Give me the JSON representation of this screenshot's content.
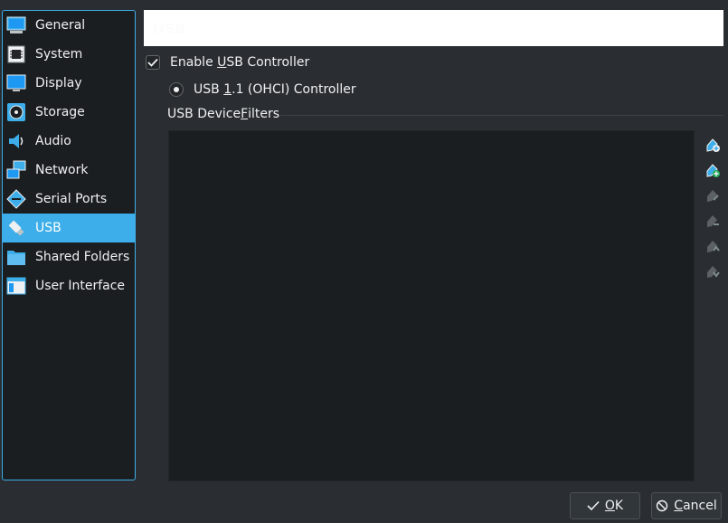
{
  "sidebar": {
    "items": [
      {
        "label": "General",
        "icon": "general-icon"
      },
      {
        "label": "System",
        "icon": "system-icon"
      },
      {
        "label": "Display",
        "icon": "display-icon"
      },
      {
        "label": "Storage",
        "icon": "storage-icon"
      },
      {
        "label": "Audio",
        "icon": "audio-icon"
      },
      {
        "label": "Network",
        "icon": "network-icon"
      },
      {
        "label": "Serial Ports",
        "icon": "serial-ports-icon"
      },
      {
        "label": "USB",
        "icon": "usb-icon",
        "selected": true
      },
      {
        "label": "Shared Folders",
        "icon": "shared-folders-icon"
      },
      {
        "label": "User Interface",
        "icon": "user-interface-icon"
      }
    ]
  },
  "page": {
    "title": "USB"
  },
  "usb": {
    "enable_label_pre": "Enable ",
    "enable_label_key": "U",
    "enable_label_post": "SB Controller",
    "enabled": true,
    "controller_pre": "USB ",
    "controller_key": "1",
    "controller_post": ".1 (OHCI) Controller",
    "filters_pre": "USB Device ",
    "filters_key": "F",
    "filters_post": "ilters"
  },
  "filter_tools": [
    "add-empty-filter-icon",
    "add-from-device-icon",
    "edit-filter-icon",
    "remove-filter-icon",
    "move-up-icon",
    "move-down-icon"
  ],
  "buttons": {
    "ok_key": "O",
    "ok_rest": "K",
    "cancel_key": "C",
    "cancel_rest": "ancel"
  },
  "colors": {
    "accent": "#3daee9",
    "background": "#2a2e32",
    "list_bg": "#1b1e20"
  }
}
